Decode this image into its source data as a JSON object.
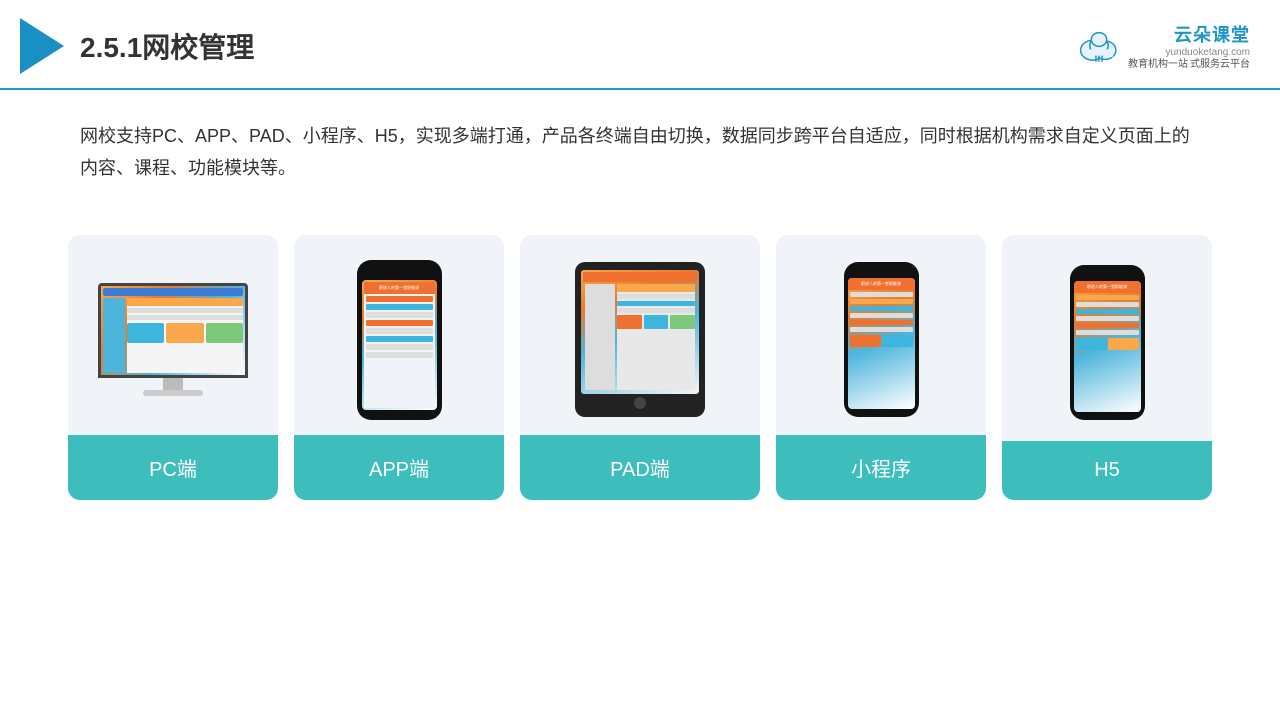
{
  "header": {
    "title": "2.5.1网校管理",
    "brand": {
      "name": "云朵课堂",
      "url": "yunduoketang.com",
      "tagline1": "教育机构一站",
      "tagline2": "式服务云平台"
    }
  },
  "description": "网校支持PC、APP、PAD、小程序、H5，实现多端打通，产品各终端自由切换，数据同步跨平台自适应，同时根据机构需求自定义页面上的内容、课程、功能模块等。",
  "cards": [
    {
      "id": "pc",
      "label": "PC端"
    },
    {
      "id": "app",
      "label": "APP端"
    },
    {
      "id": "pad",
      "label": "PAD端"
    },
    {
      "id": "miniprogram",
      "label": "小程序"
    },
    {
      "id": "h5",
      "label": "H5"
    }
  ],
  "colors": {
    "accent": "#3dbdbc",
    "headerBorder": "#2196c4",
    "brand": "#2196c4"
  }
}
